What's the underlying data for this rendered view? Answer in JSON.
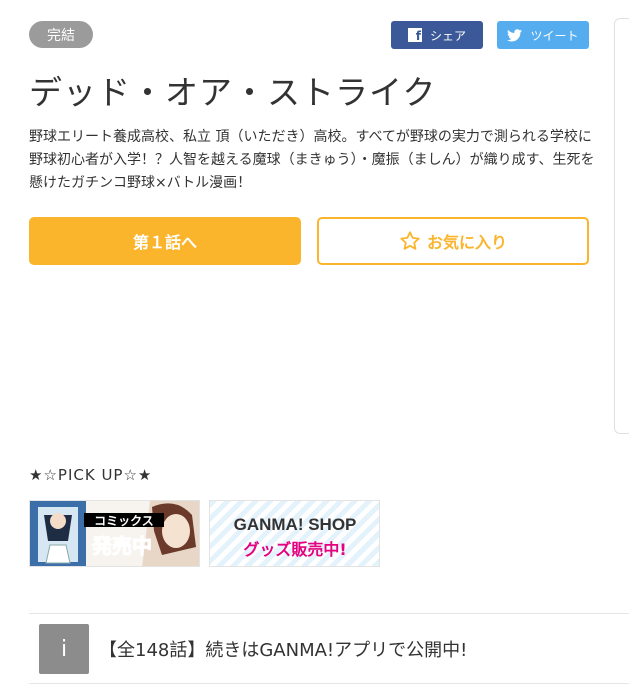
{
  "status_badge": "完結",
  "share": {
    "facebook_label": "シェア",
    "facebook_icon": "facebook-icon",
    "twitter_label": "ツイート",
    "twitter_icon": "twitter-icon"
  },
  "title": "デッド・オア・ストライク",
  "description": "野球エリート養成高校、私立 頂（いただき）高校。すべてが野球の実力で測られる学校に野球初心者が入学！？人智を越える魔球（まきゅう）・魔振（ましん）が織り成す、生死を懸けたガチンコ野球×バトル漫画！",
  "buttons": {
    "first_episode": "第１話へ",
    "favorite": "お気に入り",
    "favorite_icon": "star-outline-icon"
  },
  "pickup": {
    "title": "★☆PICK UP☆★",
    "banners": [
      {
        "line1": "コミックス",
        "line2": "発売中"
      },
      {
        "line1": "GANMA! SHOP",
        "line2": "グッズ販売中!"
      }
    ]
  },
  "notice": {
    "icon_glyph": "i",
    "text": "【全148話】続きはGANMA!アプリで公開中!"
  },
  "colors": {
    "accent": "#fbb52d",
    "facebook": "#3b5998",
    "twitter": "#55acee",
    "badge": "#9b9b9b"
  }
}
